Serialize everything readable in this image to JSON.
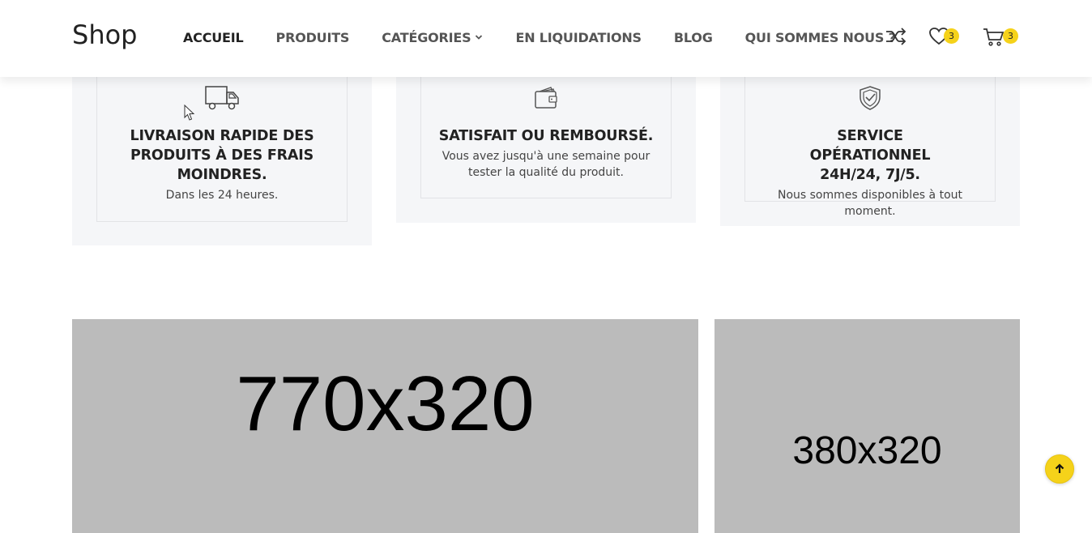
{
  "header": {
    "logo": "Shop",
    "nav": [
      {
        "label": "ACCUEIL",
        "active": true
      },
      {
        "label": "PRODUITS",
        "active": false
      },
      {
        "label": "CATÉGORIES",
        "active": false,
        "has_dropdown": true
      },
      {
        "label": "EN LIQUIDATIONS",
        "active": false
      },
      {
        "label": "BLOG",
        "active": false
      },
      {
        "label": "QUI SOMMES NOUS ?",
        "active": false
      }
    ],
    "icons": {
      "compare": "shuffle-icon",
      "wishlist": "heart-icon",
      "cart": "cart-icon"
    },
    "wishlist_count": "3",
    "cart_count": "3"
  },
  "features": [
    {
      "icon": "truck-icon",
      "title": "LIVRAISON RAPIDE DES PRODUITS À DES FRAIS MOINDRES.",
      "description": "Dans les 24 heures."
    },
    {
      "icon": "wallet-icon",
      "title": "SATISFAIT OU REMBOURSÉ.",
      "description": "Vous avez jusqu'à une semaine pour tester la qualité du produit."
    },
    {
      "icon": "shield-check-icon",
      "title": "SERVICE OPÉRATIONNEL 24H/24, 7J/5.",
      "description": "Nous sommes disponibles à tout moment."
    }
  ],
  "banners": [
    {
      "label": "770x320"
    },
    {
      "label": "380x320"
    }
  ],
  "colors": {
    "accent": "#f5d21a",
    "feature_bg": "#f5f6f8",
    "banner_bg": "#bbbbbb"
  },
  "back_to_top_icon": "arrow-up-icon"
}
